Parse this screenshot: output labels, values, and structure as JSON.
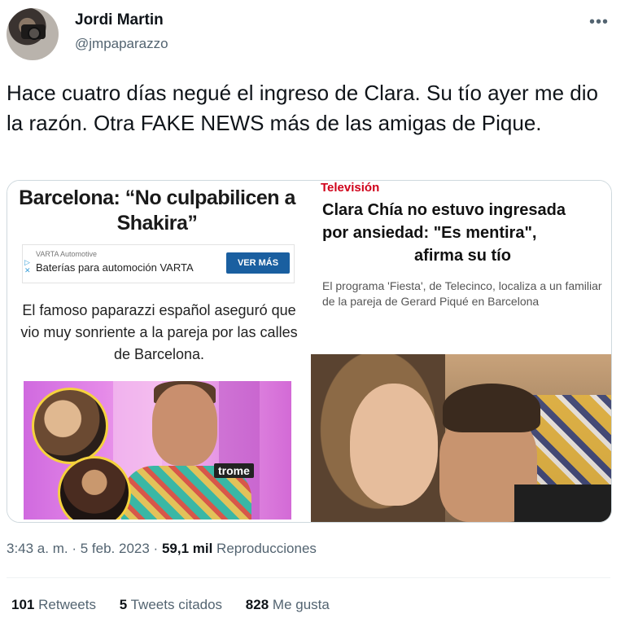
{
  "author": {
    "name": "Jordi Martin",
    "handle": "@jmpaparazzo"
  },
  "menu_icon": "more-horizontal-icon",
  "tweet_text": "Hace cuatro días negué el ingreso de Clara. Su tío ayer me dio la razón. Otra FAKE NEWS más de las amigas de Pique.",
  "left_image": {
    "headline": "Barcelona: “No culpabilicen a Shakira”",
    "ad": {
      "brand": "VARTA Automotive",
      "title": "Baterías para automoción VARTA",
      "button": "VER MÁS"
    },
    "body": "El famoso paparazzi español aseguró que vio muy sonriente a la pareja por las calles de Barcelona.",
    "logo": "trome"
  },
  "right_image": {
    "section": "Televisión",
    "headline_line1": "Clara Chía no estuvo ingresada",
    "headline_line2": "por ansiedad: \"Es mentira\",",
    "headline_line3": "afirma su tío",
    "summary": "El programa 'Fiesta', de Telecinco, localiza a un familiar de la pareja de Gerard Piqué en Barcelona"
  },
  "meta": {
    "time": "3:43 a. m.",
    "date": "5 feb. 2023",
    "views_count": "59,1 mil",
    "views_label": "Reproducciones"
  },
  "stats": {
    "retweets_count": "101",
    "retweets_label": "Retweets",
    "quotes_count": "5",
    "quotes_label": "Tweets citados",
    "likes_count": "828",
    "likes_label": "Me gusta"
  }
}
